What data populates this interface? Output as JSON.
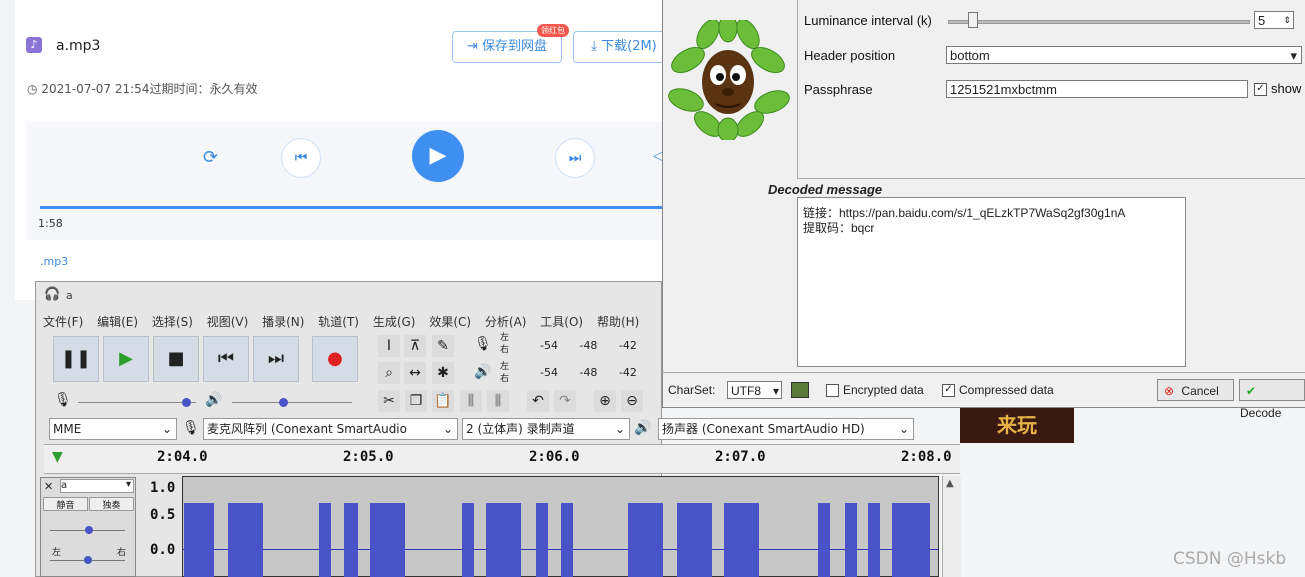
{
  "baidu": {
    "file_name": "a.mp3",
    "save_btn": "保存到网盘",
    "badge": "领红包",
    "download_btn": "下载(2M)",
    "date": "2021-07-07 21:54过期时间：永久有效",
    "time_current": "1:58",
    "file_link": ".mp3"
  },
  "audacity": {
    "title": "a",
    "menus": [
      "文件(F)",
      "编辑(E)",
      "选择(S)",
      "视图(V)",
      "播录(N)",
      "轨道(T)",
      "生成(G)",
      "效果(C)",
      "分析(A)",
      "工具(O)",
      "帮助(H)"
    ],
    "meter_left": "左",
    "meter_right": "右",
    "meter_ticks": [
      "-54",
      "-48",
      "-42"
    ],
    "host": "MME",
    "mic": "麦克风阵列 (Conexant SmartAudio",
    "channels": "2 (立体声) 录制声道",
    "speaker": "扬声器 (Conexant SmartAudio HD)",
    "ruler": [
      "2:04.0",
      "2:05.0",
      "2:06.0",
      "2:07.0",
      "2:08.0"
    ],
    "track_name": "a",
    "mute": "静音",
    "solo": "独奏",
    "pan_left": "左",
    "pan_right": "右",
    "amp": [
      "1.0",
      "0.5",
      "0.0"
    ]
  },
  "decoder": {
    "lum_label": "Luminance interval (k)",
    "lum_value": "5",
    "header_label": "Header position",
    "header_value": "bottom",
    "pass_label": "Passphrase",
    "pass_value": "1251521mxbctmm",
    "show_label": "show",
    "decoded_title": "Decoded message",
    "decoded_line1": "链接：https://pan.baidu.com/s/1_qELzkTP7WaSq2gf30g1nA",
    "decoded_line2": "提取码：bqcr",
    "charset_label": "CharSet:",
    "charset_value": "UTF8",
    "encrypted_label": "Encrypted data",
    "compressed_label": "Compressed data",
    "cancel": "Cancel",
    "decode": "Decode"
  },
  "banner_text": "来玩",
  "watermark": "CSDN @Hskb"
}
